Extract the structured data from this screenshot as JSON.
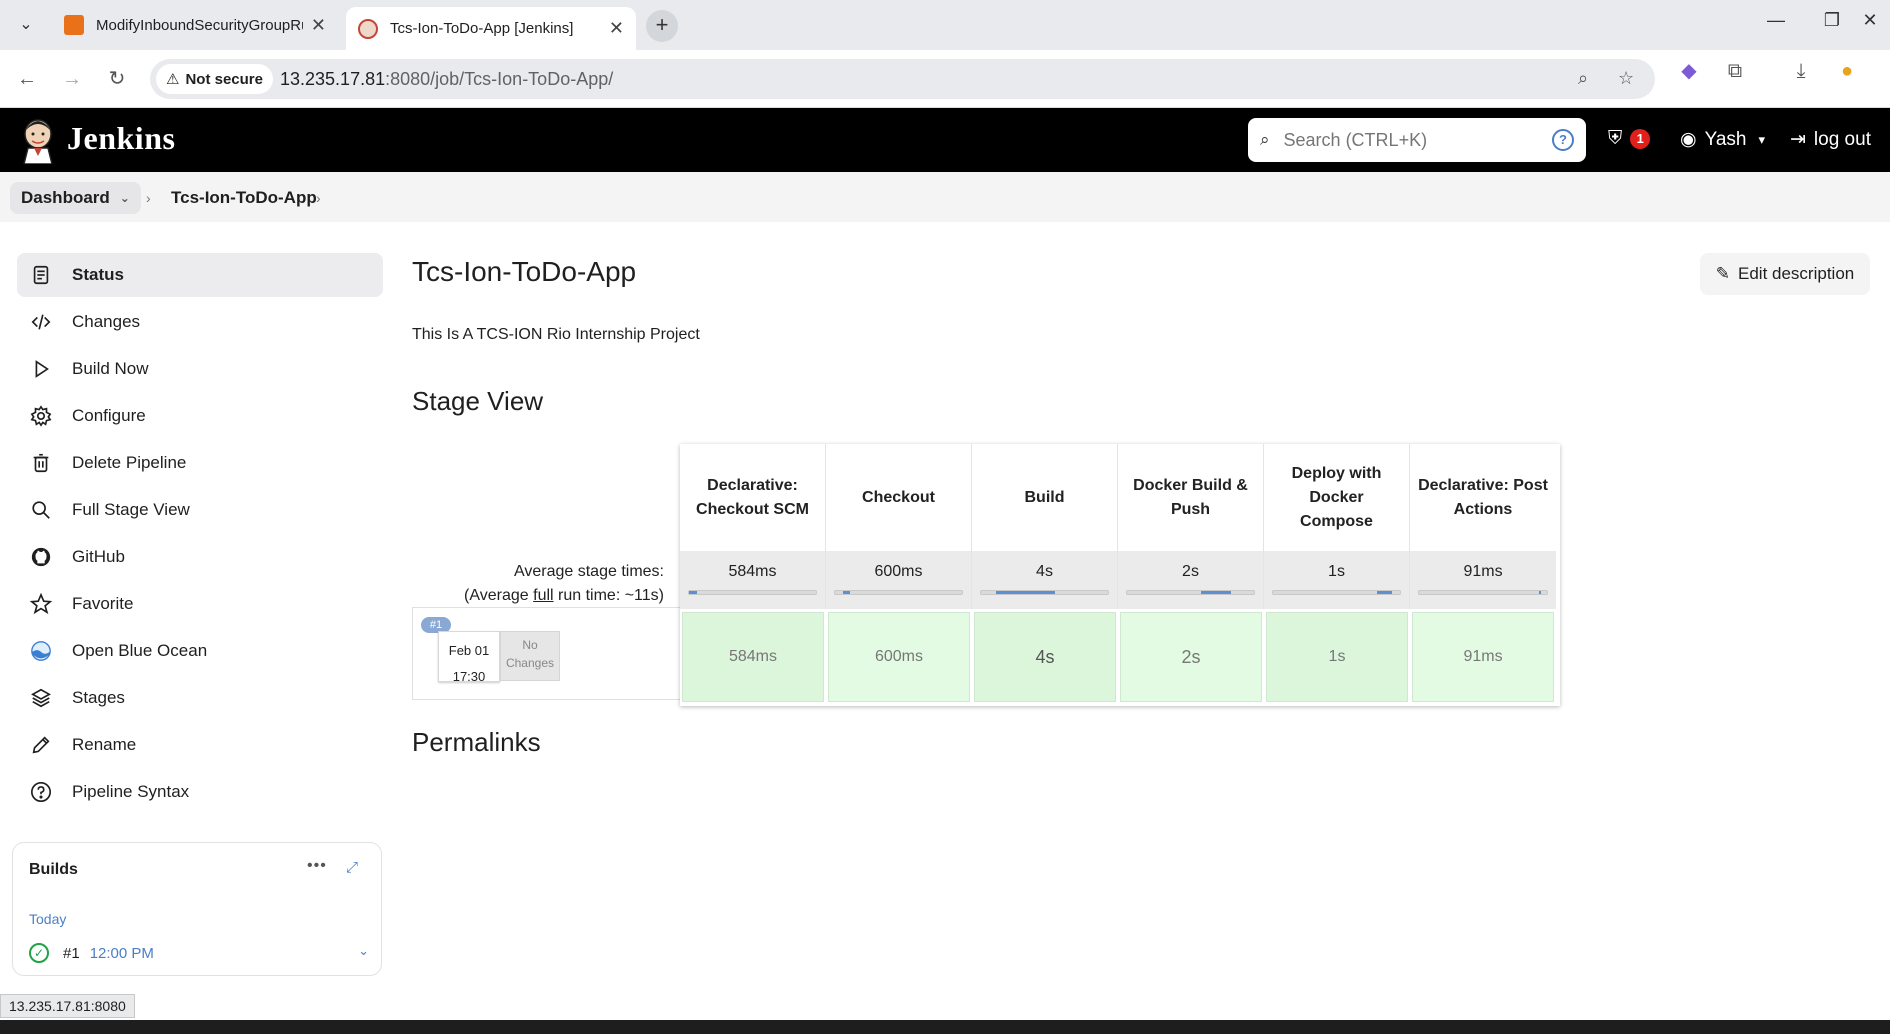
{
  "browser": {
    "tabs": [
      {
        "title": "ModifyInboundSecurityGroupRules",
        "active": false,
        "favicon": "aws-icon"
      },
      {
        "title": "Tcs-Ion-ToDo-App [Jenkins]",
        "active": true,
        "favicon": "jenkins-icon"
      }
    ],
    "security_label": "Not secure",
    "url_host": "13.235.17.81",
    "url_rest": ":8080/job/Tcs-Ion-ToDo-App/"
  },
  "header": {
    "brand": "Jenkins",
    "search_placeholder": "Search (CTRL+K)",
    "security_badge": "1",
    "user": "Yash",
    "logout": "log out"
  },
  "breadcrumb": {
    "items": [
      "Dashboard",
      "Tcs-Ion-ToDo-App"
    ]
  },
  "sidebar": {
    "items": [
      {
        "label": "Status",
        "icon": "document-icon"
      },
      {
        "label": "Changes",
        "icon": "code-icon"
      },
      {
        "label": "Build Now",
        "icon": "play-icon"
      },
      {
        "label": "Configure",
        "icon": "gear-icon"
      },
      {
        "label": "Delete Pipeline",
        "icon": "trash-icon"
      },
      {
        "label": "Full Stage View",
        "icon": "search-icon"
      },
      {
        "label": "GitHub",
        "icon": "github-icon"
      },
      {
        "label": "Favorite",
        "icon": "star-icon"
      },
      {
        "label": "Open Blue Ocean",
        "icon": "blue-ocean-icon"
      },
      {
        "label": "Stages",
        "icon": "layers-icon"
      },
      {
        "label": "Rename",
        "icon": "pencil-icon"
      },
      {
        "label": "Pipeline Syntax",
        "icon": "help-icon"
      }
    ]
  },
  "builds": {
    "title": "Builds",
    "group": "Today",
    "entries": [
      {
        "number": "#1",
        "time": "12:00 PM",
        "status": "success"
      }
    ]
  },
  "main": {
    "title": "Tcs-Ion-ToDo-App",
    "edit_description": "Edit description",
    "description": "This Is A TCS-ION Rio Internship Project",
    "stage_view_title": "Stage View",
    "permalinks_title": "Permalinks"
  },
  "stage_view": {
    "avg_label_line1": "Average stage times:",
    "avg_label_pre": "(Average ",
    "avg_label_link": "full",
    "avg_label_post": " run time: ~11s)",
    "stages": [
      {
        "name": "Declarative: Checkout SCM",
        "avg": "584ms",
        "run": "584ms"
      },
      {
        "name": "Checkout",
        "avg": "600ms",
        "run": "600ms"
      },
      {
        "name": "Build",
        "avg": "4s",
        "run": "4s"
      },
      {
        "name": "Docker Build & Push",
        "avg": "2s",
        "run": "2s"
      },
      {
        "name": "Deploy with Docker Compose",
        "avg": "1s",
        "run": "1s"
      },
      {
        "name": "Declarative: Post Actions",
        "avg": "91ms",
        "run": "91ms"
      }
    ],
    "run": {
      "badge": "#1",
      "date": "Feb 01",
      "time": "17:30",
      "changes": "No Changes"
    }
  },
  "status_url": "13.235.17.81:8080",
  "colors": {
    "jenkins_header": "#000000",
    "stage_success": "#dcf6dc",
    "progress_blue": "#5b8fd6",
    "link_blue": "#4a7fc7",
    "success_green": "#1ea446"
  }
}
